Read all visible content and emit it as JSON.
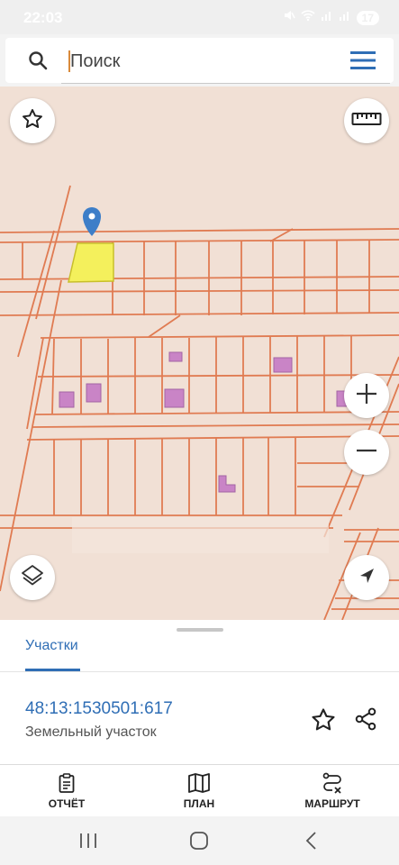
{
  "status_bar": {
    "time": "22:03",
    "battery": "17"
  },
  "search": {
    "placeholder": "Поиск"
  },
  "map": {
    "selected_parcel_color": "#f4f05c",
    "marker_color": "#3d7ec8",
    "boundary_color": "#e07b52",
    "building_color": "#c984c6",
    "background_color": "#f1e0d5",
    "buttons": {
      "favorite_icon": "star-icon",
      "ruler_icon": "ruler-icon",
      "zoom_in_icon": "plus-icon",
      "zoom_out_icon": "minus-icon",
      "layers_icon": "layers-icon",
      "locate_icon": "navigation-arrow-icon"
    }
  },
  "sheet": {
    "tab_label": "Участки",
    "parcel_number": "48:13:1530501:617",
    "parcel_type": "Земельный участок",
    "accent_color": "#2f6eb5"
  },
  "bottom_nav": {
    "items": [
      {
        "label": "ОТЧЁТ",
        "icon": "clipboard-icon"
      },
      {
        "label": "ПЛАН",
        "icon": "map-icon"
      },
      {
        "label": "МАРШРУТ",
        "icon": "route-icon"
      }
    ]
  }
}
